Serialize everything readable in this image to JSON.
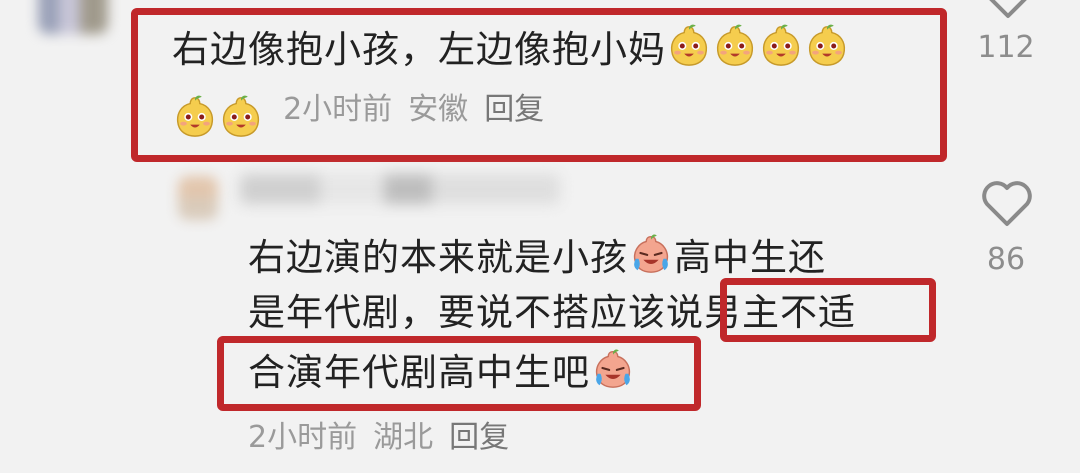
{
  "comments": [
    {
      "line1": "右边像抱小孩，左边像抱小妈",
      "time": "2小时前",
      "location": "安徽",
      "reply": "回复",
      "likes": "112",
      "emoji": "pear-smile-emoji"
    },
    {
      "line1": "右边演的本来就是小孩",
      "line1b": "高中生还",
      "line2a": "是年代剧，要说不搭应该说",
      "line2b": "男主不适",
      "line3": "合演年代剧高中生吧",
      "time": "2小时前",
      "location": "湖北",
      "reply": "回复",
      "likes": "86",
      "emoji": "laugh-cry-emoji"
    }
  ],
  "colors": {
    "highlight": "#c0282b",
    "meta": "#9a9a9a",
    "background": "#f2f2f2"
  }
}
